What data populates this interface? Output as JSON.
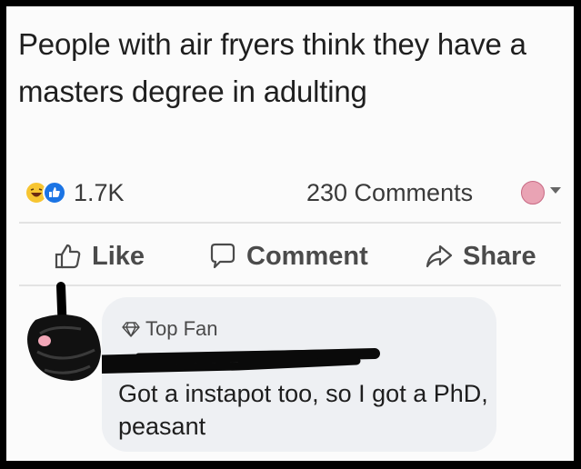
{
  "post": {
    "text": "People with air fryers think they have a masters degree in adulting"
  },
  "stats": {
    "reactions": "1.7K",
    "comments": "230 Comments",
    "colors": {
      "haha": "#f7c531",
      "like": "#1b74e4"
    }
  },
  "actions": {
    "like": "Like",
    "comment": "Comment",
    "share": "Share"
  },
  "comment": {
    "badge": "Top Fan",
    "text": "Got a instapot too, so I got a PhD,  peasant"
  },
  "icons": {
    "like": "thumbs-up-icon",
    "comment": "speech-bubble-icon",
    "share": "share-arrow-icon",
    "badge": "diamond-icon"
  }
}
